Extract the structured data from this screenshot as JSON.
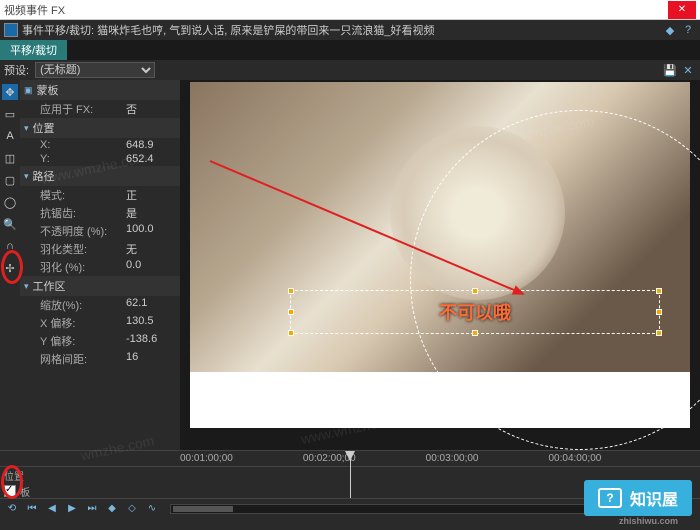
{
  "window": {
    "title": "视频事件 FX",
    "close": "✕"
  },
  "header": {
    "title": "事件平移/裁切: 猫咪炸毛也哼, 气到说人话, 原来是铲屎的带回来一只流浪猫_好看视频"
  },
  "tab": {
    "label": "平移/裁切"
  },
  "preset": {
    "label": "预设:",
    "value": "(无标题)"
  },
  "props": {
    "mask": {
      "title": "蒙板",
      "apply_label": "应用于 FX:",
      "apply_val": "否"
    },
    "pos": {
      "title": "位置",
      "x_label": "X:",
      "x_val": "648.9",
      "y_label": "Y:",
      "y_val": "652.4"
    },
    "path": {
      "title": "路径",
      "mode_label": "模式:",
      "mode_val": "正",
      "aa_label": "抗锯齿:",
      "aa_val": "是",
      "opacity_label": "不透明度 (%):",
      "opacity_val": "100.0",
      "feather_label": "羽化类型:",
      "feather_val": "无",
      "featherpct_label": "羽化 (%):",
      "featherpct_val": "0.0"
    },
    "work": {
      "title": "工作区",
      "zoom_label": "缩放(%):",
      "zoom_val": "62.1",
      "xoff_label": "X 偏移:",
      "xoff_val": "130.5",
      "yoff_label": "Y 偏移:",
      "yoff_val": "-138.6",
      "grid_label": "网格间距:",
      "grid_val": "16"
    }
  },
  "canvas": {
    "text": "不可以哦"
  },
  "timeline": {
    "ticks": [
      "00:01:00;00",
      "00:02:00;00",
      "00:03:00;00",
      "00:04:00;00"
    ],
    "track1": "位置",
    "track2": "板"
  },
  "logo": {
    "text": "知识屋",
    "sub": "zhishiwu.com"
  },
  "watermarks": [
    "www.wmzhe.com",
    "www.wmzhe.com",
    "wmzhe.com",
    "wmzhe.com"
  ]
}
